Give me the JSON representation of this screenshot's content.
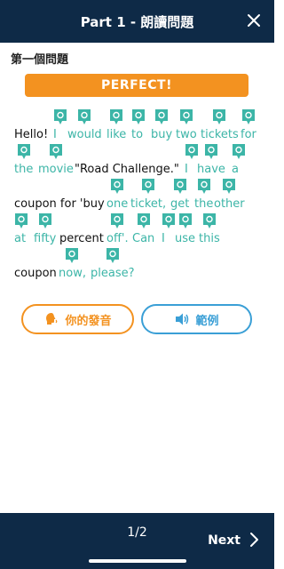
{
  "header": {
    "title": "Part 1 - 朗讀問題",
    "close_icon": "close-icon"
  },
  "question_label": "第一個問題",
  "result_badge": "PERFECT!",
  "colors": {
    "accent_orange": "#f39220",
    "correct_green": "#3cb5a7",
    "header_navy": "#0e2a47",
    "example_blue": "#3a9fd6"
  },
  "sentence_words": [
    {
      "text": "Hello!",
      "state": "plain",
      "pin": false
    },
    {
      "text": "I",
      "state": "correct",
      "pin": true
    },
    {
      "text": "would",
      "state": "correct",
      "pin": true
    },
    {
      "text": "like",
      "state": "correct",
      "pin": true
    },
    {
      "text": "to",
      "state": "correct",
      "pin": true
    },
    {
      "text": "buy",
      "state": "correct",
      "pin": true
    },
    {
      "text": "two",
      "state": "correct",
      "pin": true
    },
    {
      "text": "tickets",
      "state": "correct",
      "pin": true
    },
    {
      "text": "for",
      "state": "correct",
      "pin": true
    },
    {
      "text": "the",
      "state": "correct",
      "pin": true
    },
    {
      "text": "movie",
      "state": "correct",
      "pin": true
    },
    {
      "text": "\"Road Challenge.\"",
      "state": "plain",
      "pin": false
    },
    {
      "text": "I",
      "state": "correct",
      "pin": true
    },
    {
      "text": "have",
      "state": "correct",
      "pin": true
    },
    {
      "text": "a",
      "state": "correct",
      "pin": true
    },
    {
      "text": "coupon for 'buy",
      "state": "plain",
      "pin": false
    },
    {
      "text": "one",
      "state": "correct",
      "pin": true
    },
    {
      "text": "ticket,",
      "state": "correct",
      "pin": true
    },
    {
      "text": "get",
      "state": "correct",
      "pin": true
    },
    {
      "text": "the",
      "state": "correct",
      "pin": true
    },
    {
      "text": "other",
      "state": "correct",
      "pin": true
    },
    {
      "text": "at",
      "state": "correct",
      "pin": true
    },
    {
      "text": "fifty",
      "state": "correct",
      "pin": true
    },
    {
      "text": "percent",
      "state": "plain",
      "pin": false
    },
    {
      "text": "off'.",
      "state": "correct",
      "pin": true
    },
    {
      "text": "Can",
      "state": "correct",
      "pin": true
    },
    {
      "text": "I",
      "state": "correct",
      "pin": true
    },
    {
      "text": "use",
      "state": "correct",
      "pin": true
    },
    {
      "text": "this",
      "state": "correct",
      "pin": true
    },
    {
      "text": "coupon",
      "state": "plain",
      "pin": false
    },
    {
      "text": "now,",
      "state": "correct",
      "pin": true
    },
    {
      "text": "please?",
      "state": "correct",
      "pin": true
    }
  ],
  "pin_icon": "speech-pin-icon",
  "buttons": {
    "your_voice": "你的發音",
    "your_voice_icon": "speaking-head-icon",
    "example": "範例",
    "example_icon": "speaker-icon"
  },
  "footer": {
    "page": "1/2",
    "next": "Next",
    "next_icon": "chevron-right-icon"
  }
}
